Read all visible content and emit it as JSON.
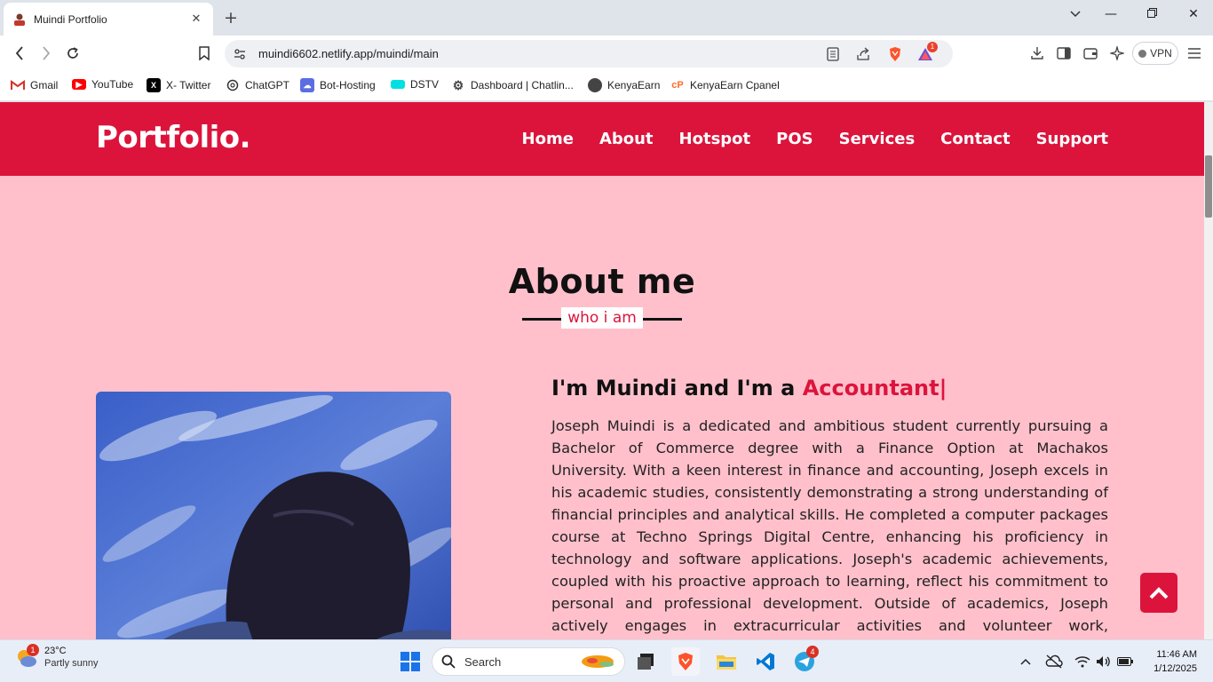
{
  "browser": {
    "tab": {
      "title": "Muindi Portfolio"
    },
    "address": {
      "url": "muindi6602.netlify.app/muindi/main"
    },
    "vpn_label": "VPN",
    "brave_rewards_count": "1",
    "bookmarks": [
      {
        "label": "Gmail",
        "icon": "gmail-icon"
      },
      {
        "label": "YouTube",
        "icon": "youtube-icon"
      },
      {
        "label": "X- Twitter",
        "icon": "x-icon"
      },
      {
        "label": "ChatGPT",
        "icon": "chatgpt-icon"
      },
      {
        "label": "Bot-Hosting",
        "icon": "cloud-icon"
      },
      {
        "label": "DSTV",
        "icon": "dstv-icon"
      },
      {
        "label": "Dashboard | Chatlin...",
        "icon": "gear-icon"
      },
      {
        "label": "KenyaEarn",
        "icon": "kenyaearn-icon"
      },
      {
        "label": "KenyaEarn Cpanel",
        "icon": "cpanel-icon"
      }
    ]
  },
  "site": {
    "logo": "Portfolio.",
    "nav": [
      "Home",
      "About",
      "Hotspot",
      "POS",
      "Services",
      "Contact",
      "Support"
    ],
    "about": {
      "title": "About me",
      "subtitle": "who i am",
      "intro_prefix": "I'm Muindi and I'm a ",
      "intro_role": "Accountant|",
      "bio": "Joseph Muindi is a dedicated and ambitious student currently pursuing a Bachelor of Commerce degree with a Finance Option at Machakos University. With a keen interest in finance and accounting, Joseph excels in his academic studies, consistently demonstrating a strong understanding of financial principles and analytical skills. He completed a computer packages course at Techno Springs Digital Centre, enhancing his proficiency in technology and software applications. Joseph's academic achievements, coupled with his proactive approach to learning, reflect his commitment to personal and professional development. Outside of academics, Joseph actively engages in extracurricular activities and volunteer work, showcasing his leadership"
    },
    "colors": {
      "accent": "#dc143c",
      "background": "#ffc0cb"
    }
  },
  "taskbar": {
    "weather": {
      "temp": "23°C",
      "condition": "Partly sunny",
      "badge": "1"
    },
    "search_placeholder": "Search",
    "telegram_badge": "4",
    "clock": {
      "time": "11:46 AM",
      "date": "1/12/2025"
    }
  }
}
